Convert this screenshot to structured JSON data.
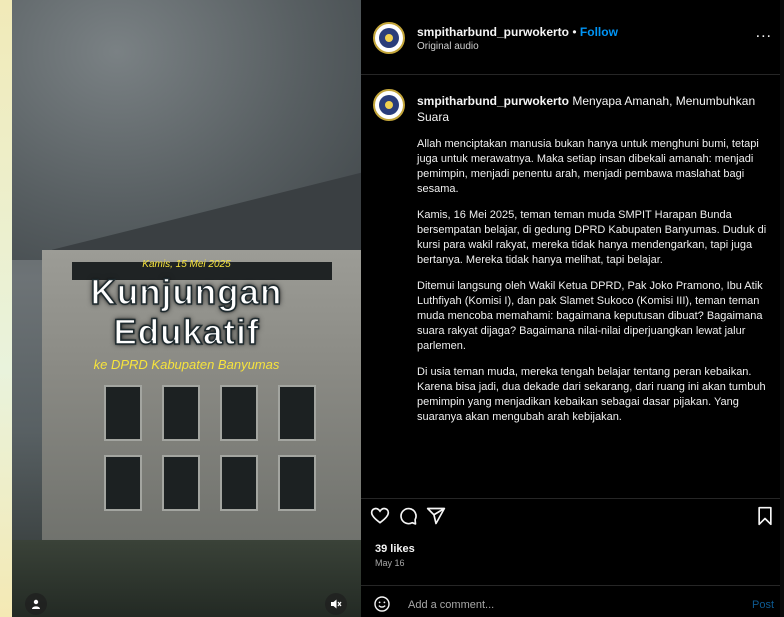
{
  "video": {
    "date_text": "Kamis, 15 Mei 2025",
    "title_line1": "Kunjungan",
    "title_line2": "Edukatif",
    "subtitle": "ke DPRD Kabupaten Banyumas",
    "profile_icon": "person-icon",
    "mute_icon": "speaker-muted-icon"
  },
  "header": {
    "username": "smpitharbund_purwokerto",
    "separator": "•",
    "follow_label": "Follow",
    "audio": "Original audio",
    "more_label": "..."
  },
  "caption": {
    "username": "smpitharbund_purwokerto",
    "headline": "Menyapa Amanah, Menumbuhkan Suara",
    "paragraphs": [
      "Allah menciptakan manusia bukan hanya untuk menghuni bumi, tetapi juga untuk merawatnya. Maka setiap insan dibekali amanah: menjadi pemimpin, menjadi penentu arah, menjadi pembawa maslahat bagi sesama.",
      "Kamis, 16 Mei 2025, teman teman muda SMPIT Harapan Bunda bersempatan belajar, di gedung DPRD Kabupaten Banyumas. Duduk di kursi para wakil rakyat, mereka tidak hanya mendengarkan, tapi juga bertanya. Mereka tidak hanya melihat, tapi belajar.",
      "Ditemui langsung oleh Wakil Ketua DPRD, Pak Joko Pramono, Ibu Atik Luthfiyah (Komisi I), dan pak Slamet Sukoco (Komisi III), teman teman muda mencoba memahami: bagaimana keputusan dibuat? Bagaimana suara rakyat dijaga? Bagaimana nilai-nilai diperjuangkan lewat jalur parlemen.",
      "Di usia teman muda, mereka tengah belajar tentang peran kebaikan. Karena bisa jadi, dua dekade dari sekarang, dari ruang ini akan tumbuh pemimpin yang menjadikan kebaikan sebagai dasar pijakan. Yang suaranya akan mengubah arah kebijakan."
    ]
  },
  "actions": {
    "like_icon": "heart-icon",
    "comment_icon": "comment-icon",
    "share_icon": "send-icon",
    "save_icon": "bookmark-icon"
  },
  "stats": {
    "likes": "39 likes",
    "date": "May 16"
  },
  "comment": {
    "placeholder": "Add a comment...",
    "post_label": "Post",
    "emoji_icon": "emoji-icon"
  },
  "colors": {
    "accent_blue": "#0095f6",
    "video_text_yellow": "#f7e43c",
    "panel_bg": "#000000"
  }
}
